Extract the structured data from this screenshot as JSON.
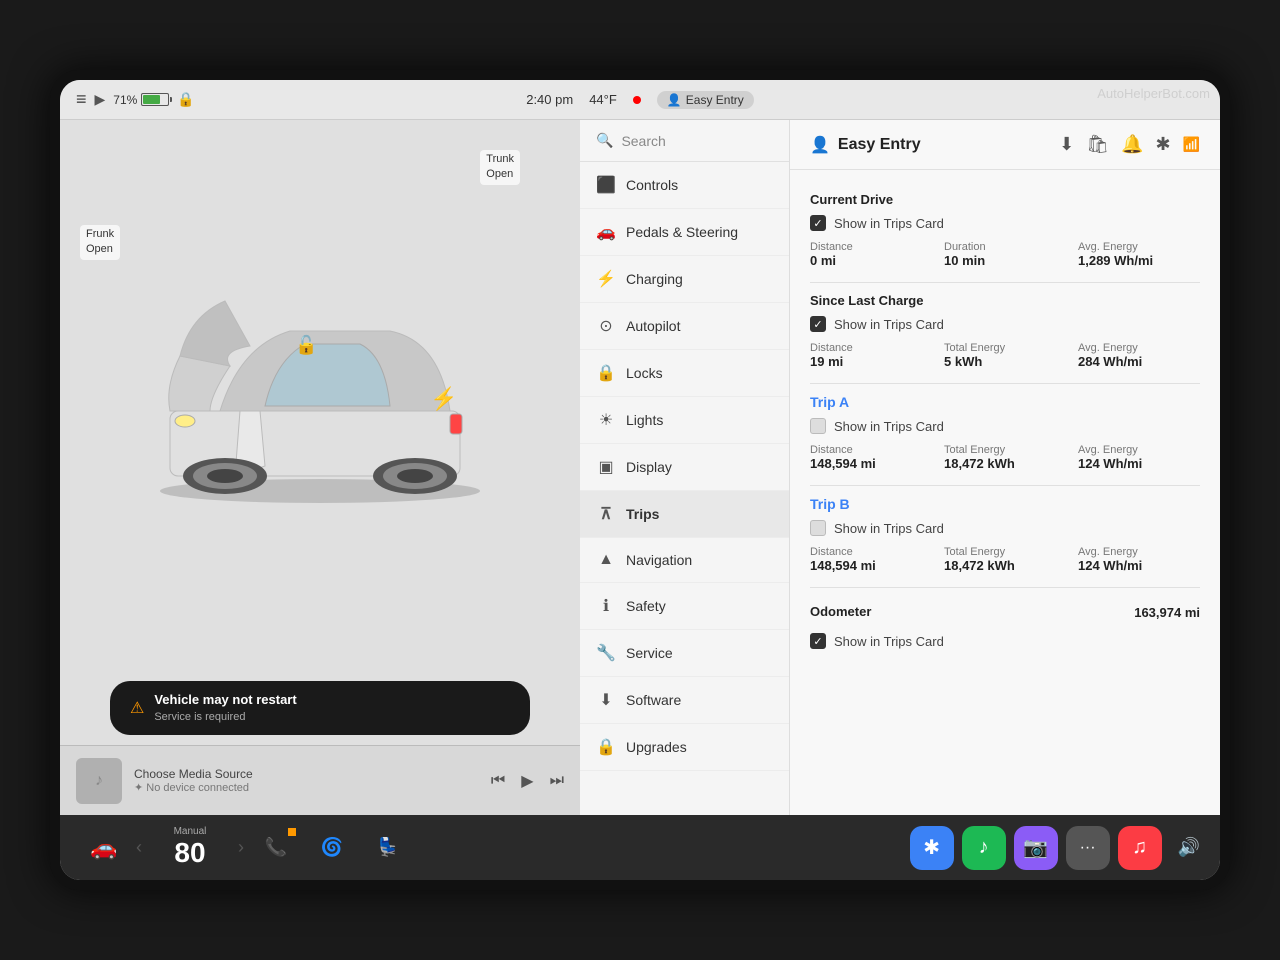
{
  "watermark": "AutoHelperBot.com",
  "status_bar": {
    "battery_pct": "71%",
    "time": "2:40 pm",
    "temp": "44°F",
    "profile": "Easy Entry"
  },
  "car": {
    "frunk_label": "Frunk\nOpen",
    "trunk_label": "Trunk\nOpen",
    "warning_title": "Vehicle may not restart",
    "warning_sub": "Service is required"
  },
  "media": {
    "title": "Choose Media Source",
    "sub": "✦ No device connected"
  },
  "taskbar": {
    "speed_label": "Manual",
    "speed_value": "80",
    "apps": [
      "🔵",
      "🟢",
      "🟣",
      "···",
      "🔴"
    ]
  },
  "menu": {
    "search_placeholder": "Search",
    "items": [
      {
        "id": "controls",
        "icon": "⬛",
        "label": "Controls"
      },
      {
        "id": "pedals",
        "icon": "🚗",
        "label": "Pedals & Steering"
      },
      {
        "id": "charging",
        "icon": "⚡",
        "label": "Charging"
      },
      {
        "id": "autopilot",
        "icon": "🔄",
        "label": "Autopilot"
      },
      {
        "id": "locks",
        "icon": "🔒",
        "label": "Locks"
      },
      {
        "id": "lights",
        "icon": "💡",
        "label": "Lights"
      },
      {
        "id": "display",
        "icon": "📺",
        "label": "Display"
      },
      {
        "id": "trips",
        "icon": "📍",
        "label": "Trips",
        "active": true
      },
      {
        "id": "navigation",
        "icon": "▲",
        "label": "Navigation"
      },
      {
        "id": "safety",
        "icon": "ℹ",
        "label": "Safety"
      },
      {
        "id": "service",
        "icon": "🔧",
        "label": "Service"
      },
      {
        "id": "software",
        "icon": "⬇",
        "label": "Software"
      },
      {
        "id": "upgrades",
        "icon": "🔒",
        "label": "Upgrades"
      }
    ]
  },
  "settings": {
    "title": "Easy Entry",
    "title_icon": "👤",
    "sections": {
      "current_drive": {
        "label": "Current Drive",
        "show_trips_checked": true,
        "show_trips_label": "Show in Trips Card",
        "stats": [
          {
            "label": "Distance",
            "value": "0 mi"
          },
          {
            "label": "Duration",
            "value": "10 min"
          },
          {
            "label": "Avg. Energy",
            "value": "1,289 Wh/mi"
          }
        ]
      },
      "since_last_charge": {
        "label": "Since Last Charge",
        "show_trips_checked": true,
        "show_trips_label": "Show in Trips Card",
        "stats": [
          {
            "label": "Distance",
            "value": "19 mi"
          },
          {
            "label": "Total Energy",
            "value": "5 kWh"
          },
          {
            "label": "Avg. Energy",
            "value": "284 Wh/mi"
          }
        ]
      },
      "trip_a": {
        "label": "Trip A",
        "show_trips_checked": false,
        "show_trips_label": "Show in Trips Card",
        "stats": [
          {
            "label": "Distance",
            "value": "148,594 mi"
          },
          {
            "label": "Total Energy",
            "value": "18,472 kWh"
          },
          {
            "label": "Avg. Energy",
            "value": "124 Wh/mi"
          }
        ]
      },
      "trip_b": {
        "label": "Trip B",
        "show_trips_checked": false,
        "show_trips_label": "Show in Trips Card",
        "stats": [
          {
            "label": "Distance",
            "value": "148,594 mi"
          },
          {
            "label": "Total Energy",
            "value": "18,472 kWh"
          },
          {
            "label": "Avg. Energy",
            "value": "124 Wh/mi"
          }
        ]
      },
      "odometer": {
        "label": "Odometer",
        "value": "163,974 mi",
        "show_trips_checked": true,
        "show_trips_label": "Show in Trips Card"
      }
    }
  }
}
